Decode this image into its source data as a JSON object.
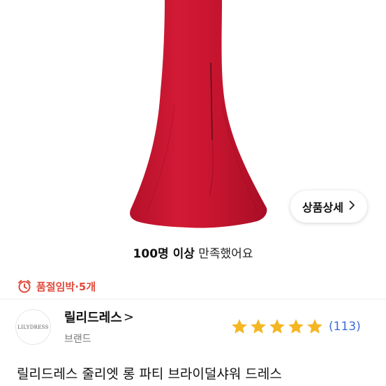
{
  "image": {
    "alt_icon": "red-mermaid-dress-image"
  },
  "detail_button": {
    "label": "상품상세",
    "icon": "chevron-right-icon"
  },
  "satisfaction": {
    "highlight": "100명 이상",
    "rest": "만족했어요"
  },
  "stock_notice": {
    "icon": "alarm-clock-icon",
    "text": "품절임박·5개",
    "color": "#e04a3b"
  },
  "brand": {
    "logo_text": "LILYDRESS",
    "name": "릴리드레스",
    "chevron": ">",
    "label": "브랜드"
  },
  "rating": {
    "stars": 5,
    "count_text": "(113)",
    "star_color": "#f5b623",
    "count_color": "#3b6fd8"
  },
  "product": {
    "title": "릴리드레스 줄리엣 롱 파티 브라이덜샤워 드레스"
  }
}
